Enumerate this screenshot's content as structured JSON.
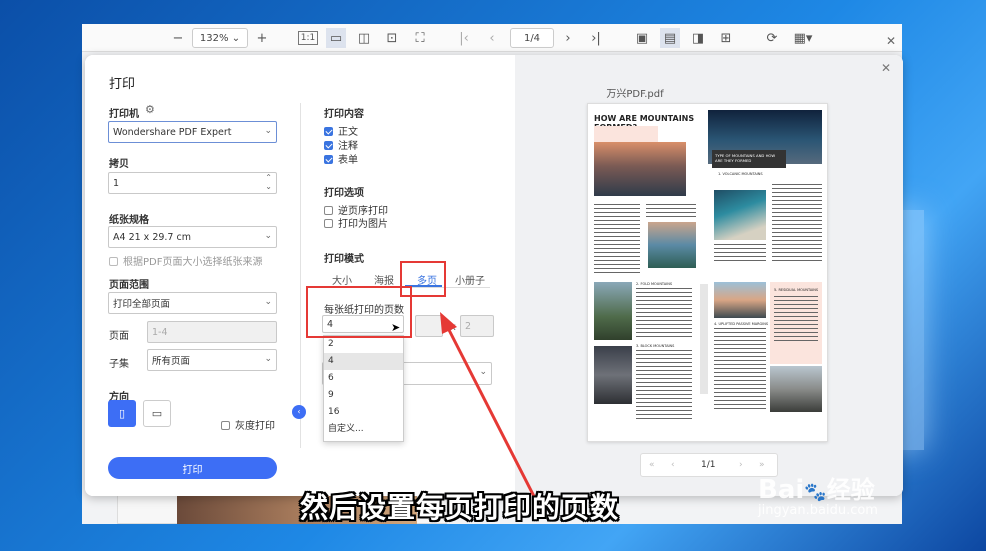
{
  "toolbar": {
    "zoom_value": "132%",
    "page_value": "1/4"
  },
  "dialog": {
    "title": "打印",
    "printer_label": "打印机",
    "printer_value": "Wondershare PDF Expert",
    "copies_label": "拷贝",
    "copies_value": "1",
    "paper_label": "纸张规格",
    "paper_value": "A4 21 x 29.7 cm",
    "paper_source_checkbox": "根据PDF页面大小选择纸张来源",
    "range_label": "页面范围",
    "range_value": "打印全部页面",
    "pages_label": "页面",
    "pages_placeholder": "1-4",
    "subset_label": "子集",
    "subset_value": "所有页面",
    "orientation_label": "方向",
    "grayscale_label": "灰度打印",
    "print_button": "打印",
    "content_label": "打印内容",
    "content_items": [
      "正文",
      "注释",
      "表单"
    ],
    "options_label": "打印选项",
    "option_items": [
      "逆页序打印",
      "打印为图片"
    ],
    "mode_label": "打印模式",
    "mode_tabs": [
      "大小",
      "海报",
      "多页",
      "小册子"
    ],
    "pages_per_sheet_label": "每张纸打印的页数",
    "pages_per_sheet_value": "4",
    "grid_x_label": "x",
    "grid_right_value": "2",
    "dropdown_options": [
      "2",
      "4",
      "6",
      "9",
      "16",
      "自定义..."
    ]
  },
  "preview": {
    "filename": "万兴PDF.pdf",
    "pager_text": "1/1",
    "doc_title": "HOW ARE MOUNTAINS FORMED?",
    "doc_subtitle": "TYPE OF MOUNTAINS AND HOW ARE THEY FORMED",
    "sections": [
      "1. VOLCANIC MOUNTAINS",
      "2. FOLD MOUNTAINS",
      "3. BLOCK MOUNTAINS",
      "4. UPLIFTED PASSIVE MARGINS",
      "5. RESIDUAL MOUNTAINS"
    ]
  },
  "caption": "然后设置每页打印的页数",
  "watermark": {
    "brand": "Bai",
    "brand2": "经验",
    "url": "jingyan.baidu.com"
  },
  "colors": {
    "accent": "#3d6ef5",
    "highlight_box": "#e53935",
    "arrow": "#e53935"
  }
}
